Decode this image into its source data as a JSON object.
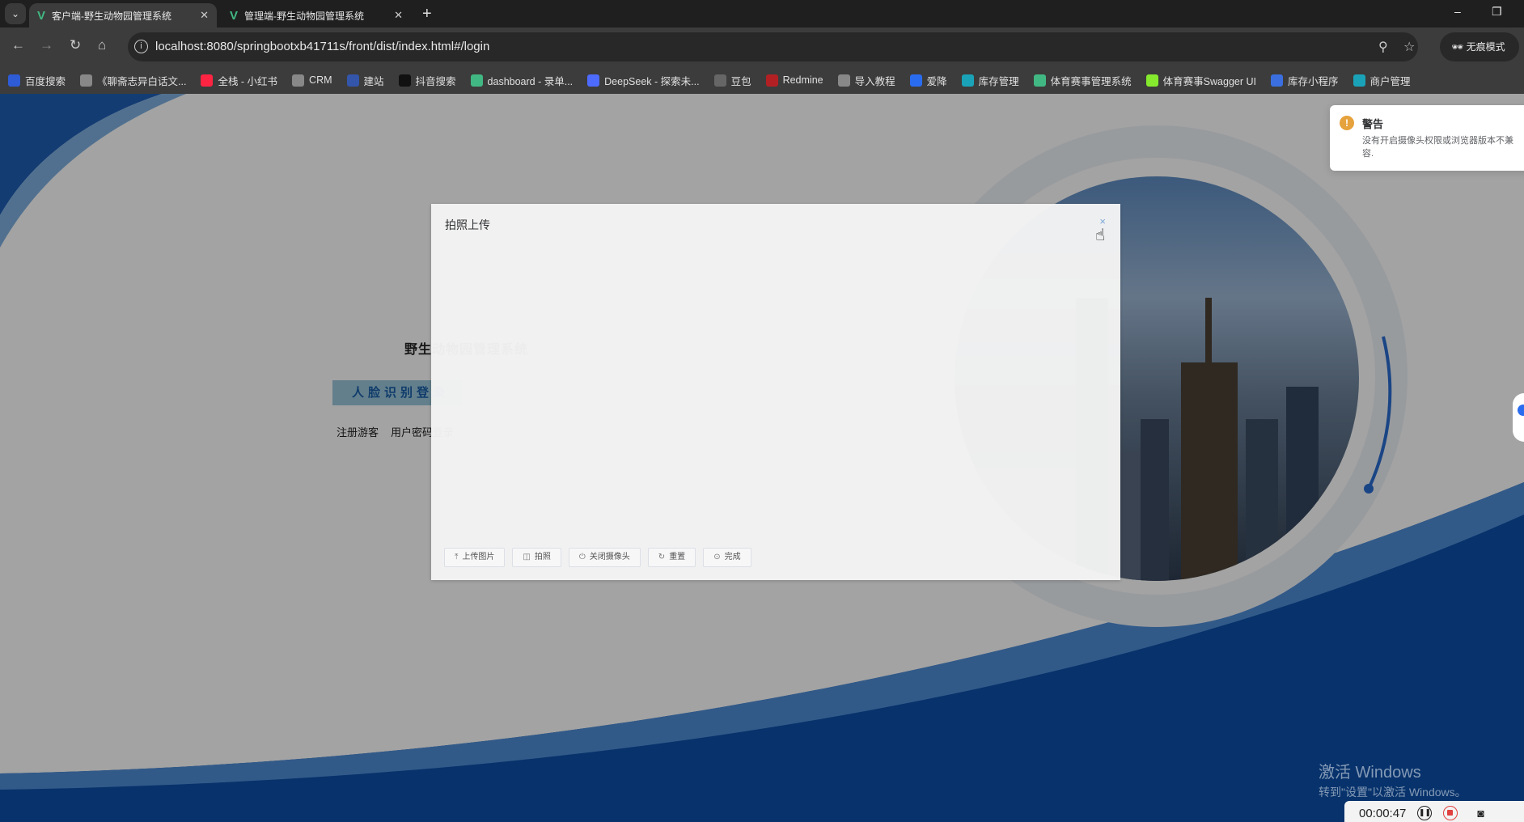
{
  "browser": {
    "tabs": [
      {
        "title": "客户端-野生动物园管理系统",
        "active": true
      },
      {
        "title": "管理端-野生动物园管理系统",
        "active": false
      }
    ],
    "url": "localhost:8080/springbootxb41711s/front/dist/index.html#/login",
    "incognito_label": "无痕模式",
    "bookmarks": [
      {
        "label": "百度搜索",
        "color": "#2e5bd6"
      },
      {
        "label": "《聊斋志异白话文...",
        "color": "#888888"
      },
      {
        "label": "全栈 - 小红书",
        "color": "#ff2442"
      },
      {
        "label": "CRM",
        "color": "#888888"
      },
      {
        "label": "建站",
        "color": "#3355aa"
      },
      {
        "label": "抖音搜索",
        "color": "#111111"
      },
      {
        "label": "dashboard - 录单...",
        "color": "#41b883"
      },
      {
        "label": "DeepSeek - 探索未...",
        "color": "#4d6bfe"
      },
      {
        "label": "豆包",
        "color": "#666666"
      },
      {
        "label": "Redmine",
        "color": "#b32024"
      },
      {
        "label": "导入教程",
        "color": "#888888"
      },
      {
        "label": "爱降",
        "color": "#2a6cf0"
      },
      {
        "label": "库存管理",
        "color": "#1aa3b8"
      },
      {
        "label": "体育赛事管理系统",
        "color": "#41b883"
      },
      {
        "label": "体育赛事Swagger UI",
        "color": "#85ea2d"
      },
      {
        "label": "库存小程序",
        "color": "#3b6fe0"
      },
      {
        "label": "商户管理",
        "color": "#1aa3b8"
      }
    ]
  },
  "login": {
    "title": "野生动物园管理系统",
    "face_login": "人脸识别登录",
    "register": "注册游客",
    "password_login": "用户密码登录"
  },
  "dialog": {
    "title": "拍照上传",
    "close": "×",
    "buttons": [
      {
        "label": "上传图片",
        "icon": "upload-icon",
        "glyph": "⤒"
      },
      {
        "label": "拍照",
        "icon": "camera-icon",
        "glyph": "◫"
      },
      {
        "label": "关闭摄像头",
        "icon": "power-icon",
        "glyph": "⏻"
      },
      {
        "label": "重置",
        "icon": "refresh-icon",
        "glyph": "↻"
      },
      {
        "label": "完成",
        "icon": "check-circle-icon",
        "glyph": "⊙"
      }
    ]
  },
  "toast": {
    "type": "warning",
    "title": "警告",
    "message": "没有开启摄像头权限或浏览器版本不兼容."
  },
  "watermark": {
    "line1": "激活 Windows",
    "line2": "转到\"设置\"以激活 Windows。"
  },
  "recorder": {
    "time": "00:00:47"
  },
  "colors": {
    "accent_blue": "#1a5fa8",
    "warning": "#e6a23c"
  }
}
